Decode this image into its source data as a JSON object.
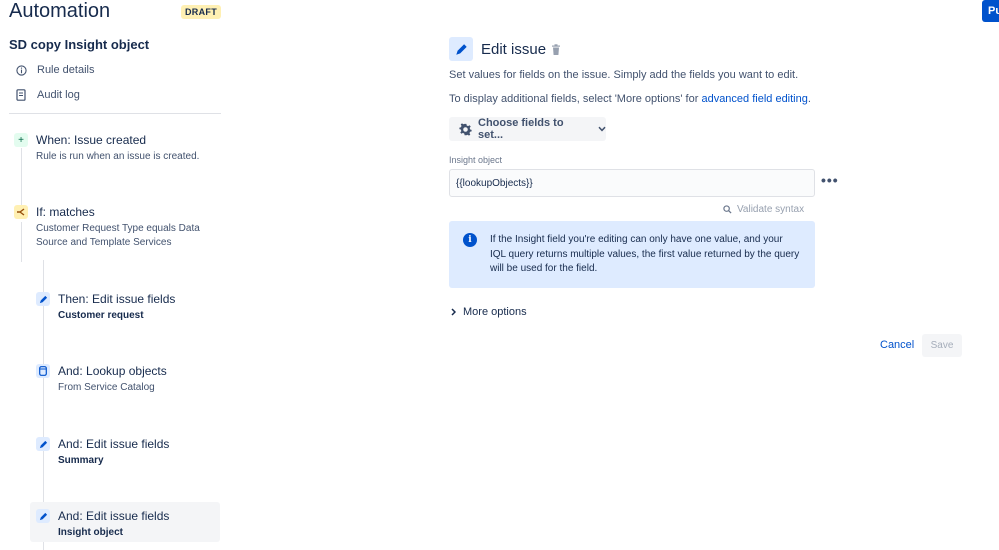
{
  "header": {
    "title": "Automation",
    "draft_badge": "DRAFT",
    "publish_label": "Pu"
  },
  "sidebar": {
    "rule_name": "SD copy Insight object",
    "links": [
      {
        "label": "Rule details",
        "icon": "info-icon"
      },
      {
        "label": "Audit log",
        "icon": "document-icon"
      }
    ],
    "nodes": [
      {
        "title": "When: Issue created",
        "subtitle": "Rule is run when an issue is created.",
        "icon": "plus-icon"
      },
      {
        "title": "If: matches",
        "subtitle": "Customer Request Type equals Data Source and Template Services",
        "icon": "branch-icon"
      },
      {
        "title": "Then: Edit issue fields",
        "subtitle": "Customer request",
        "icon": "pencil-icon"
      },
      {
        "title": "And: Lookup objects",
        "subtitle": "From Service Catalog",
        "icon": "database-icon"
      },
      {
        "title": "And: Edit issue fields",
        "subtitle": "Summary",
        "icon": "pencil-icon"
      },
      {
        "title": "And: Edit issue fields",
        "subtitle": "Insight object",
        "icon": "pencil-icon"
      }
    ]
  },
  "panel": {
    "title": "Edit issue",
    "description": "Set values for fields on the issue. Simply add the fields you want to edit.",
    "additional_prefix": "To display additional fields, select 'More options' for ",
    "additional_link": "advanced field editing",
    "additional_suffix": ".",
    "choose_fields_label": "Choose fields to set...",
    "field_label": "Insight object",
    "field_value": "{{lookupObjects}}",
    "more_dots": "•••",
    "validate_label": "Validate syntax",
    "info_text": "If the Insight field you're editing can only have one value, and your IQL query returns multiple values, the first value returned by the query will be used for the field.",
    "more_options_label": "More options",
    "cancel_label": "Cancel",
    "save_label": "Save"
  },
  "colors": {
    "accent": "#0052cc",
    "info_bg": "#deebff",
    "draft_bg": "#fff0b3",
    "trigger_green": "#006644"
  }
}
